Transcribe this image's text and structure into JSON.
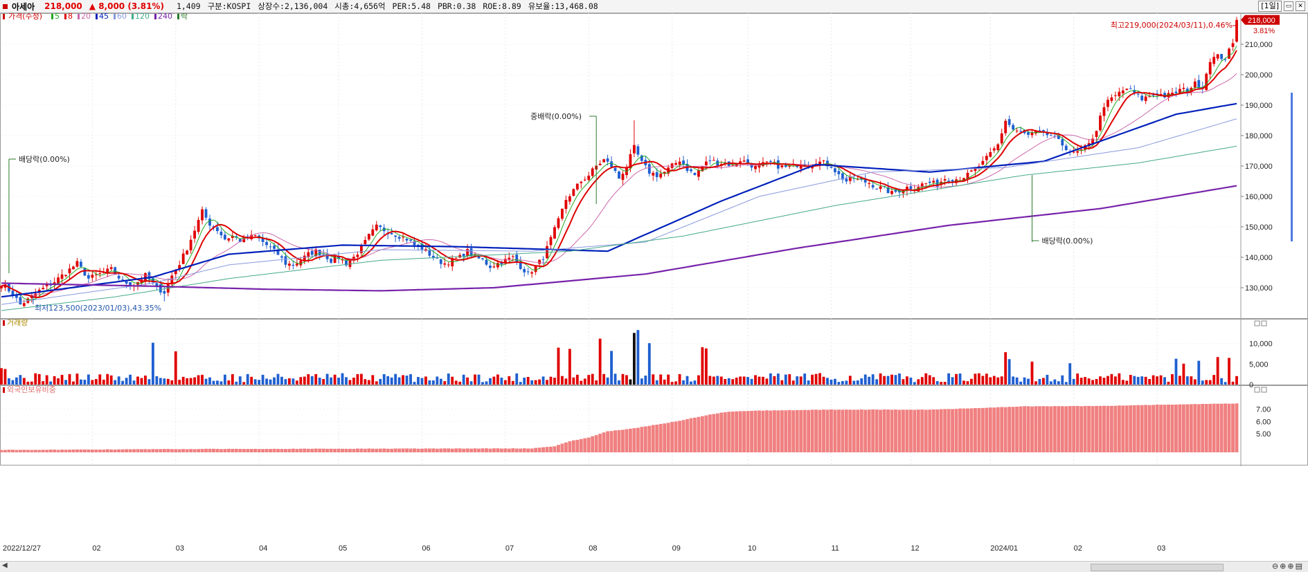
{
  "header": {
    "name": "아세아",
    "price": "218,000",
    "change": "▲ 8,000",
    "change_pct": "(3.81%)",
    "volume": "1,409",
    "market": "구분:KOSPI",
    "shares": "상장수:2,136,004",
    "mktcap": "시총:4,656억",
    "per": "PER:5.48",
    "pbr": "PBR:0.38",
    "roe": "ROE:8.89",
    "float": "유보율:13,468.08",
    "period_label": "[1일]",
    "up_color": "#e00000",
    "down_color": "#1f5fd0"
  },
  "legend": {
    "price_label": "가격(수정)",
    "ma": [
      {
        "label": "5",
        "color": "#22aa22"
      },
      {
        "label": "8",
        "color": "#dd0000"
      },
      {
        "label": "20",
        "color": "#cc66aa"
      },
      {
        "label": "45",
        "color": "#0020bb"
      },
      {
        "label": "60",
        "color": "#8899dd"
      },
      {
        "label": "120",
        "color": "#44aa88"
      },
      {
        "label": "240",
        "color": "#7722aa"
      }
    ],
    "drop_label": "락",
    "volume_label": "거래량",
    "foreign_label": "외국인보유비중"
  },
  "annotations": {
    "high": "최고219,000(2024/03/11),0.46%",
    "low": "최저123,500(2023/01/03),43.35%",
    "dividend1": "배당락(0.00%)",
    "dividend2": "배당락(0.00%)",
    "middiv": "중배락(0.00%)",
    "last_price": "218,000",
    "last_pct": "3.81%"
  },
  "chart_data": {
    "type": "candlestick",
    "start_date": "2022/12/27",
    "x_labels": [
      "2022/12/27",
      "02",
      "03",
      "04",
      "05",
      "06",
      "07",
      "08",
      "09",
      "10",
      "11",
      "12",
      "2024/01",
      "02",
      "03"
    ],
    "price_axis": {
      "min": 120000,
      "max": 220000,
      "ticks": [
        "130,000",
        "140,000",
        "150,000",
        "160,000",
        "170,000",
        "180,000",
        "190,000",
        "200,000",
        "210,000"
      ]
    },
    "volume_axis": {
      "min": 0,
      "max": 14000,
      "ticks": [
        "0",
        "5,000",
        "10,000"
      ]
    },
    "foreign_axis": {
      "min": 3.5,
      "max": 8.2,
      "ticks": [
        "5.00",
        "6.00",
        "7.00"
      ]
    },
    "close_anchors": [
      [
        0,
        131500
      ],
      [
        3,
        128000
      ],
      [
        5,
        124500
      ],
      [
        7,
        126000
      ],
      [
        10,
        129000
      ],
      [
        14,
        132000
      ],
      [
        17,
        135000
      ],
      [
        20,
        138000
      ],
      [
        23,
        133000
      ],
      [
        26,
        134500
      ],
      [
        29,
        136000
      ],
      [
        32,
        132000
      ],
      [
        35,
        131000
      ],
      [
        38,
        134000
      ],
      [
        41,
        130000
      ],
      [
        43,
        128500
      ],
      [
        45,
        134000
      ],
      [
        47,
        138000
      ],
      [
        49,
        143000
      ],
      [
        51,
        149000
      ],
      [
        53,
        155000
      ],
      [
        55,
        151000
      ],
      [
        57,
        149000
      ],
      [
        59,
        146000
      ],
      [
        61,
        147000
      ],
      [
        63,
        145500
      ],
      [
        65,
        146500
      ],
      [
        67,
        147000
      ],
      [
        69,
        145000
      ],
      [
        71,
        143000
      ],
      [
        73,
        141000
      ],
      [
        75,
        138000
      ],
      [
        77,
        137500
      ],
      [
        79,
        139000
      ],
      [
        81,
        141000
      ],
      [
        83,
        142000
      ],
      [
        85,
        141000
      ],
      [
        87,
        139000
      ],
      [
        89,
        140000
      ],
      [
        91,
        138000
      ],
      [
        93,
        140000
      ],
      [
        95,
        143000
      ],
      [
        97,
        147000
      ],
      [
        99,
        150000
      ],
      [
        101,
        149000
      ],
      [
        103,
        148000
      ],
      [
        105,
        147000
      ],
      [
        107,
        146000
      ],
      [
        109,
        144000
      ],
      [
        111,
        143000
      ],
      [
        113,
        141000
      ],
      [
        115,
        139000
      ],
      [
        117,
        138000
      ],
      [
        119,
        139000
      ],
      [
        121,
        140000
      ],
      [
        123,
        142000
      ],
      [
        125,
        140000
      ],
      [
        127,
        139000
      ],
      [
        129,
        137000
      ],
      [
        131,
        138000
      ],
      [
        133,
        139000
      ],
      [
        135,
        140000
      ],
      [
        137,
        137000
      ],
      [
        139,
        134500
      ],
      [
        141,
        137000
      ],
      [
        143,
        140000
      ],
      [
        145,
        146000
      ],
      [
        147,
        152000
      ],
      [
        149,
        159000
      ],
      [
        151,
        162000
      ],
      [
        153,
        165000
      ],
      [
        155,
        167000
      ],
      [
        157,
        170000
      ],
      [
        159,
        172000
      ],
      [
        161,
        170000
      ],
      [
        163,
        166000
      ],
      [
        165,
        170000
      ],
      [
        167,
        176000
      ],
      [
        169,
        171000
      ],
      [
        171,
        168000
      ],
      [
        173,
        167000
      ],
      [
        175,
        168000
      ],
      [
        177,
        170000
      ],
      [
        179,
        172000
      ],
      [
        181,
        169000
      ],
      [
        183,
        167000
      ],
      [
        185,
        170000
      ],
      [
        187,
        172000
      ],
      [
        189,
        171000
      ],
      [
        191,
        171000
      ],
      [
        193,
        170000
      ],
      [
        195,
        172000
      ],
      [
        197,
        171000
      ],
      [
        199,
        169500
      ],
      [
        201,
        170500
      ],
      [
        203,
        171000
      ],
      [
        205,
        170000
      ],
      [
        207,
        169500
      ],
      [
        209,
        170000
      ],
      [
        211,
        171000
      ],
      [
        213,
        170000
      ],
      [
        215,
        171500
      ],
      [
        217,
        171000
      ],
      [
        219,
        170000
      ],
      [
        221,
        167000
      ],
      [
        223,
        165000
      ],
      [
        225,
        166000
      ],
      [
        227,
        165000
      ],
      [
        229,
        164500
      ],
      [
        231,
        163000
      ],
      [
        233,
        162500
      ],
      [
        235,
        161000
      ],
      [
        237,
        162000
      ],
      [
        239,
        163000
      ],
      [
        241,
        163000
      ],
      [
        243,
        164000
      ],
      [
        245,
        164500
      ],
      [
        247,
        164000
      ],
      [
        249,
        166000
      ],
      [
        251,
        165500
      ],
      [
        253,
        166000
      ],
      [
        255,
        167000
      ],
      [
        257,
        169000
      ],
      [
        259,
        171000
      ],
      [
        261,
        174000
      ],
      [
        263,
        177000
      ],
      [
        265,
        185000
      ],
      [
        267,
        182000
      ],
      [
        269,
        181000
      ],
      [
        271,
        180000
      ],
      [
        273,
        181000
      ],
      [
        275,
        180500
      ],
      [
        277,
        180000
      ],
      [
        279,
        178000
      ],
      [
        281,
        176000
      ],
      [
        283,
        174000
      ],
      [
        285,
        175000
      ],
      [
        287,
        177000
      ],
      [
        289,
        182000
      ],
      [
        291,
        190000
      ],
      [
        293,
        192000
      ],
      [
        295,
        194000
      ],
      [
        297,
        195500
      ],
      [
        299,
        194000
      ],
      [
        301,
        192000
      ],
      [
        303,
        193000
      ],
      [
        305,
        194000
      ],
      [
        307,
        193000
      ],
      [
        309,
        193500
      ],
      [
        311,
        195000
      ],
      [
        313,
        195000
      ],
      [
        315,
        197000
      ],
      [
        317,
        196000
      ],
      [
        319,
        205000
      ],
      [
        321,
        206000
      ],
      [
        323,
        205500
      ],
      [
        325,
        210000
      ],
      [
        326,
        218000
      ]
    ],
    "moving_averages": [
      {
        "name": "45",
        "color": "#0020bb",
        "points": [
          [
            0,
            127000
          ],
          [
            40,
            133500
          ],
          [
            60,
            141000
          ],
          [
            90,
            144000
          ],
          [
            120,
            143500
          ],
          [
            160,
            142000
          ],
          [
            190,
            158500
          ],
          [
            215,
            170500
          ],
          [
            245,
            168000
          ],
          [
            275,
            171500
          ],
          [
            310,
            187000
          ],
          [
            326,
            190500
          ]
        ]
      },
      {
        "name": "60",
        "color": "#8899dd",
        "points": [
          [
            0,
            124500
          ],
          [
            40,
            131500
          ],
          [
            60,
            137500
          ],
          [
            100,
            142500
          ],
          [
            140,
            142000
          ],
          [
            170,
            145000
          ],
          [
            200,
            160000
          ],
          [
            230,
            168000
          ],
          [
            265,
            169500
          ],
          [
            300,
            176000
          ],
          [
            326,
            185500
          ]
        ]
      },
      {
        "name": "120",
        "color": "#44aa88",
        "points": [
          [
            0,
            122500
          ],
          [
            30,
            127000
          ],
          [
            60,
            133000
          ],
          [
            100,
            139000
          ],
          [
            150,
            142000
          ],
          [
            180,
            147000
          ],
          [
            220,
            157000
          ],
          [
            270,
            167000
          ],
          [
            300,
            171000
          ],
          [
            326,
            176500
          ]
        ]
      },
      {
        "name": "240",
        "color": "#7722aa",
        "points": [
          [
            0,
            131500
          ],
          [
            40,
            130500
          ],
          [
            70,
            129500
          ],
          [
            100,
            129000
          ],
          [
            130,
            130000
          ],
          [
            170,
            134500
          ],
          [
            210,
            143000
          ],
          [
            250,
            150500
          ],
          [
            290,
            156000
          ],
          [
            326,
            163500
          ]
        ]
      }
    ],
    "volume_spikes": {
      "40": 10200,
      "46": 8100,
      "147": 9000,
      "150": 8700,
      "158": 11200,
      "161": 8200,
      "167": 12600,
      "168": 13300,
      "171": 10100,
      "185": 9100,
      "186": 8800,
      "265": 7900,
      "266": 6200,
      "272": 5600,
      "282": 5200,
      "310": 6300,
      "312": 5100,
      "316": 5800,
      "321": 6700,
      "324": 6500
    },
    "foreign_ratio_anchors": [
      [
        0,
        3.7
      ],
      [
        20,
        3.72
      ],
      [
        40,
        3.76
      ],
      [
        60,
        3.78
      ],
      [
        100,
        3.8
      ],
      [
        140,
        3.82
      ],
      [
        146,
        4.0
      ],
      [
        150,
        4.4
      ],
      [
        155,
        4.7
      ],
      [
        160,
        5.2
      ],
      [
        166,
        5.4
      ],
      [
        172,
        5.7
      ],
      [
        178,
        6.0
      ],
      [
        186,
        6.5
      ],
      [
        192,
        6.8
      ],
      [
        200,
        6.88
      ],
      [
        220,
        6.96
      ],
      [
        245,
        6.95
      ],
      [
        270,
        7.22
      ],
      [
        290,
        7.25
      ],
      [
        305,
        7.35
      ],
      [
        326,
        7.45
      ]
    ],
    "dividend_markers": [
      {
        "index": 2,
        "label_key": "dividend1"
      },
      {
        "index": 157,
        "label_key": "middiv"
      },
      {
        "index": 272,
        "label_key": "dividend2"
      }
    ],
    "high_point": {
      "index": 326,
      "value": 219000
    },
    "low_point": {
      "index": 4,
      "value": 123500
    }
  }
}
